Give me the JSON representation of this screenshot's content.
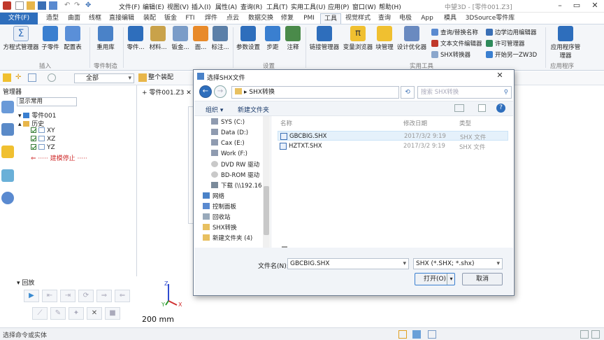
{
  "app": {
    "title": "中望3D",
    "doc_title": "[零件001.Z3]",
    "menus": [
      "文件(F)",
      "编辑(E)",
      "视图(V)",
      "插入(I)",
      "属性(A)",
      "查询(R)",
      "工具(T)",
      "实用工具(U)",
      "应用(P)",
      "窗口(W)",
      "帮助(H)"
    ]
  },
  "tabs": [
    {
      "label": "文件(F)"
    },
    {
      "label": "造型"
    },
    {
      "label": "曲面"
    },
    {
      "label": "线框"
    },
    {
      "label": "直接编辑"
    },
    {
      "label": "装配"
    },
    {
      "label": "钣金"
    },
    {
      "label": "FTI"
    },
    {
      "label": "焊件"
    },
    {
      "label": "点云"
    },
    {
      "label": "数据交换"
    },
    {
      "label": "修复"
    },
    {
      "label": "PMI"
    },
    {
      "label": "工具"
    },
    {
      "label": "视觉样式"
    },
    {
      "label": "查询"
    },
    {
      "label": "电极"
    },
    {
      "label": "App"
    },
    {
      "label": "模具"
    },
    {
      "label": "3DSource零件库"
    }
  ],
  "ribbon": {
    "buttons": [
      {
        "label": "方程式管理器"
      },
      {
        "label": "子零件"
      },
      {
        "label": "配置表"
      },
      {
        "label": "重用库"
      },
      {
        "label": "零件..."
      },
      {
        "label": "材料..."
      },
      {
        "label": "钣金..."
      },
      {
        "label": "面..."
      },
      {
        "label": "标注..."
      },
      {
        "label": "参数设置"
      },
      {
        "label": "步距"
      },
      {
        "label": "注释"
      },
      {
        "label": "链接管理器"
      },
      {
        "label": "变量浏览器"
      },
      {
        "label": "块管理"
      },
      {
        "label": "设计优化器"
      },
      {
        "label": "应用程序管理器"
      }
    ],
    "small_buttons": [
      "查询/替换名称",
      "文本文件编辑器",
      "SHX转换器",
      "边学边用编辑器",
      "许可管理器",
      "开始另一ZW3D"
    ],
    "groups": [
      "插入",
      "零件制造",
      "设置",
      "实用工具",
      "应用程序"
    ]
  },
  "toolbar": {
    "filter_value": "全部",
    "assembly_value": "整个装配"
  },
  "manager": {
    "title": "管理器",
    "filter": "显示常用",
    "root": "零件001",
    "history": "历史",
    "items": [
      "XY",
      "XZ",
      "YZ"
    ],
    "stop_label": "建模停止"
  },
  "doc_tab": "零件001.Z3",
  "playback": {
    "title": "回放"
  },
  "viewport": {
    "scale": "200 mm",
    "axes": [
      "Z",
      "X",
      "Y"
    ]
  },
  "status": {
    "text": "选择命令或实体"
  },
  "dialog": {
    "title": "选择SHX文件",
    "address": "SHX转换",
    "search_placeholder": "搜索 SHX转换",
    "organize": "组织 ▾",
    "new_folder": "新建文件夹",
    "nav_items": [
      "SYS (C:)",
      "Data (D:)",
      "Cax (E:)",
      "Work (F:)",
      "DVD RW 驱动",
      "BD-ROM 驱动",
      "下载 (\\\\192.16",
      "网络",
      "控制面板",
      "回收站",
      "SHX转换",
      "新建文件夹 (4)"
    ],
    "columns": {
      "name": "名称",
      "date": "修改日期",
      "type": "类型"
    },
    "files": [
      {
        "name": "GBCBIG.SHX",
        "date": "2017/3/2 9:19",
        "type": "SHX 文件"
      },
      {
        "name": "HZTXT.SHX",
        "date": "2017/3/2 9:19",
        "type": "SHX 文件"
      }
    ],
    "filename_label": "文件名(N):",
    "filename_value": "GBCBIG.SHX",
    "filetype_value": "SHX (*.SHX; *.shx)",
    "open_label": "打开(O)",
    "cancel_label": "取消"
  },
  "colors": {
    "accent": "#2e6ebc",
    "selection": "#cce4f7"
  }
}
